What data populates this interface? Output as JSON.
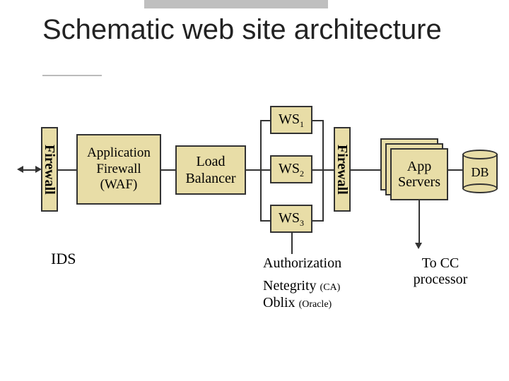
{
  "title": "Schematic web site architecture",
  "firewall_left_label": "Firewall",
  "firewall_right_label": "Firewall",
  "waf": {
    "line1": "Application",
    "line2": "Firewall",
    "line3": "(WAF)"
  },
  "load_balancer": {
    "line1": "Load",
    "line2": "Balancer"
  },
  "ws": {
    "ws1": {
      "base": "WS",
      "sub": "1"
    },
    "ws2": {
      "base": "WS",
      "sub": "2"
    },
    "ws3": {
      "base": "WS",
      "sub": "3"
    }
  },
  "app_servers": {
    "line1": "App",
    "line2": "Servers"
  },
  "db_label": "DB",
  "ids_label": "IDS",
  "authorization": "Authorization",
  "netegrity": {
    "text": "Netegrity",
    "paren": "(CA)"
  },
  "oblix": {
    "text": "Oblix",
    "paren": "(Oracle)"
  },
  "to_cc": {
    "line1": "To CC",
    "line2": "processor"
  }
}
